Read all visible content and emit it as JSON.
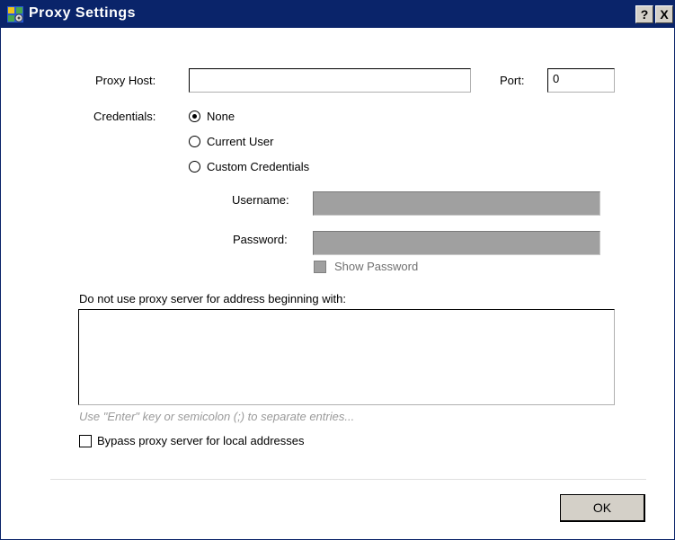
{
  "window": {
    "title": "Proxy Settings",
    "help_button": "?",
    "close_button": "X",
    "app_icon": "settings-app-icon"
  },
  "form": {
    "proxy_host_label": "Proxy Host:",
    "proxy_host_value": "",
    "port_label": "Port:",
    "port_value": "0",
    "credentials_label": "Credentials:",
    "credential_options": [
      {
        "label": "None",
        "selected": true
      },
      {
        "label": "Current User",
        "selected": false
      },
      {
        "label": "Custom Credentials",
        "selected": false
      }
    ],
    "username_label": "Username:",
    "username_value": "",
    "password_label": "Password:",
    "password_value": "",
    "show_password_label": "Show Password",
    "show_password_checked": false
  },
  "bypass": {
    "list_label": "Do not use proxy server for address beginning with:",
    "list_value": "",
    "hint": "Use \"Enter\" key or semicolon (;) to separate entries...",
    "local_checkbox_label": "Bypass proxy server for local addresses",
    "local_checked": false
  },
  "footer": {
    "ok_label": "OK"
  },
  "colors": {
    "titlebar": "#0a246a",
    "disabled_field": "#a0a0a0",
    "button_face": "#d4d0c8"
  }
}
